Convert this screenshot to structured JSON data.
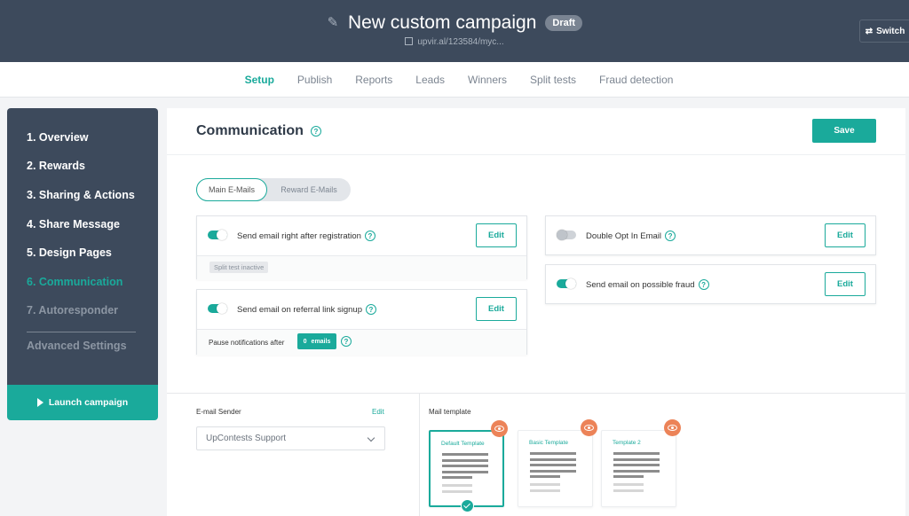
{
  "header": {
    "title": "New custom campaign",
    "status_badge": "Draft",
    "url": "upvir.al/123584/myc...",
    "switch_label": "Switch"
  },
  "tabs": [
    "Setup",
    "Publish",
    "Reports",
    "Leads",
    "Winners",
    "Split tests",
    "Fraud detection"
  ],
  "active_tab": "Setup",
  "sidebar": {
    "items": [
      "1. Overview",
      "2. Rewards",
      "3. Sharing & Actions",
      "4. Share Message",
      "5. Design Pages",
      "6. Communication",
      "7. Autoresponder"
    ],
    "advanced": "Advanced Settings",
    "launch_label": "Launch campaign"
  },
  "main": {
    "title": "Communication",
    "save_label": "Save",
    "segments": [
      "Main E-Mails",
      "Reward E-Mails"
    ],
    "cards": {
      "registration": {
        "label": "Send email right after registration",
        "enabled": true,
        "edit": "Edit",
        "chip": "Split test inactive"
      },
      "referral": {
        "label": "Send email on referral link signup",
        "enabled": true,
        "edit": "Edit",
        "pause_text": "Pause notifications after",
        "pause_count": "0",
        "pause_unit": "emails"
      },
      "double_opt": {
        "label": "Double Opt In Email",
        "enabled": false,
        "edit": "Edit"
      },
      "fraud": {
        "label": "Send email on possible fraud",
        "enabled": true,
        "edit": "Edit"
      }
    },
    "sender": {
      "label": "E-mail Sender",
      "edit": "Edit",
      "value": "UpContests Support"
    },
    "templates": {
      "label": "Mail template",
      "items": [
        "Default Template",
        "Basic Template",
        "Template 2"
      ],
      "selected": "Default Template"
    }
  },
  "colors": {
    "accent": "#1aaa9b",
    "header": "#3d4a5c",
    "eye": "#ec8358"
  }
}
